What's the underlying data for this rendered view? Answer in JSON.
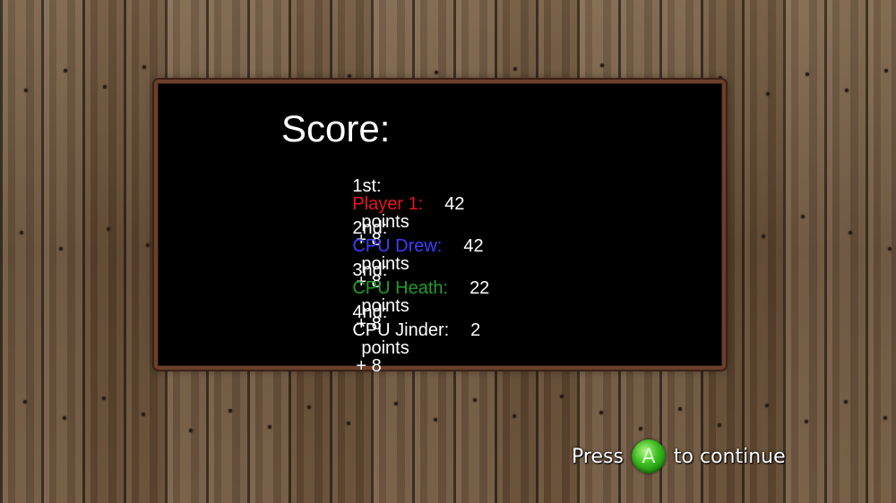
{
  "scoreboard": {
    "title": "Score:",
    "rows": [
      {
        "place": "1st:",
        "name": "Player 1:",
        "name_color": "#e8141b",
        "points": "42",
        "points_label": "points",
        "bonus": "+ 8"
      },
      {
        "place": "2nd:",
        "name": "CPU Drew:",
        "name_color": "#3a3dff",
        "points": "42",
        "points_label": "points",
        "bonus": "+ 8"
      },
      {
        "place": "3nd:",
        "name": "CPU Heath:",
        "name_color": "#1f9d2a",
        "points": "22",
        "points_label": "points",
        "bonus": "+ 8"
      },
      {
        "place": "4nd:",
        "name": "CPU Jinder:",
        "name_color": "#ffffff",
        "points": "2",
        "points_label": "points",
        "bonus": "+ 8"
      }
    ]
  },
  "prompt": {
    "press": "Press",
    "button_letter": "A",
    "button_color": "#3fbf22",
    "continue": "to continue"
  }
}
